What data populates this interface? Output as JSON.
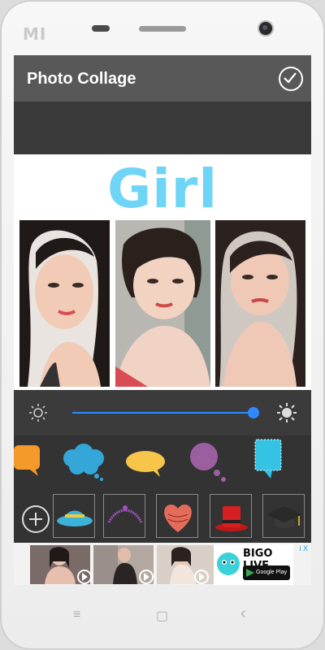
{
  "device": {
    "brand_mark": "MI"
  },
  "appbar": {
    "title": "Photo Collage",
    "confirm_icon": "check-circle-icon"
  },
  "collage": {
    "title_text": "Girl",
    "title_color": "#6fd5f7",
    "photos": [
      "photo-1",
      "photo-2",
      "photo-3"
    ]
  },
  "brightness": {
    "level": 0.94,
    "low_icon": "sun-low-icon",
    "high_icon": "sun-high-icon",
    "accent": "#2d8bff"
  },
  "bubbles": [
    "orange-bubble",
    "blue-cloud-bubble",
    "yellow-oval-bubble",
    "purple-round-bubble",
    "cyan-note-bubble"
  ],
  "stickers": [
    "hat-sticker",
    "tiara-sticker",
    "heart-sticker",
    "top-hat-sticker",
    "graduation-cap-sticker"
  ],
  "ad": {
    "brand_text": "BIGO LIVE",
    "store_text": "Google Play",
    "info_label": "i X"
  },
  "nav": {
    "menu_icon": "≡",
    "home_icon": "▢",
    "back_icon": "‹"
  }
}
